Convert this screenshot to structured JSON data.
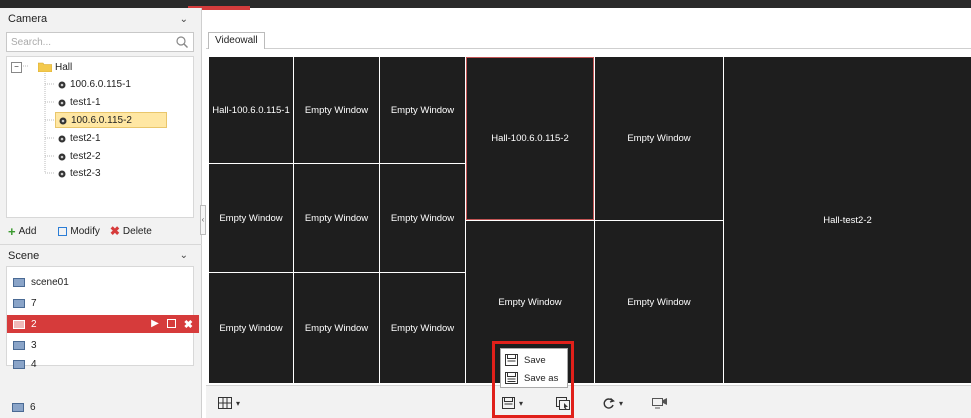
{
  "camera_panel": {
    "title": "Camera",
    "search_placeholder": "Search...",
    "tree": {
      "group": "Hall",
      "cameras": [
        "100.6.0.115-1",
        "test1-1",
        "100.6.0.115-2",
        "test2-1",
        "test2-2",
        "test2-3"
      ],
      "selected": "100.6.0.115-2"
    },
    "actions": {
      "add": "Add",
      "modify": "Modify",
      "delete": "Delete"
    }
  },
  "scene_panel": {
    "title": "Scene",
    "items": [
      "scene01",
      "7",
      "2",
      "3",
      "4",
      "6"
    ],
    "active": "2"
  },
  "main": {
    "tab": "Videowall",
    "windows": [
      "Hall-100.6.0.115-1",
      "Empty Window",
      "Empty Window",
      "Hall-100.6.0.115-2",
      "Empty Window",
      "Hall-test2-2",
      "Empty Window",
      "Empty Window",
      "Empty Window",
      "Empty Window",
      "Empty Window",
      "Empty Window",
      "Empty Window",
      "Empty Window"
    ]
  },
  "save_menu": {
    "save": "Save",
    "save_as": "Save as"
  },
  "colors": {
    "accent": "#d63b3b",
    "window_bg": "#1e1e1e",
    "highlight": "#e0201a"
  }
}
